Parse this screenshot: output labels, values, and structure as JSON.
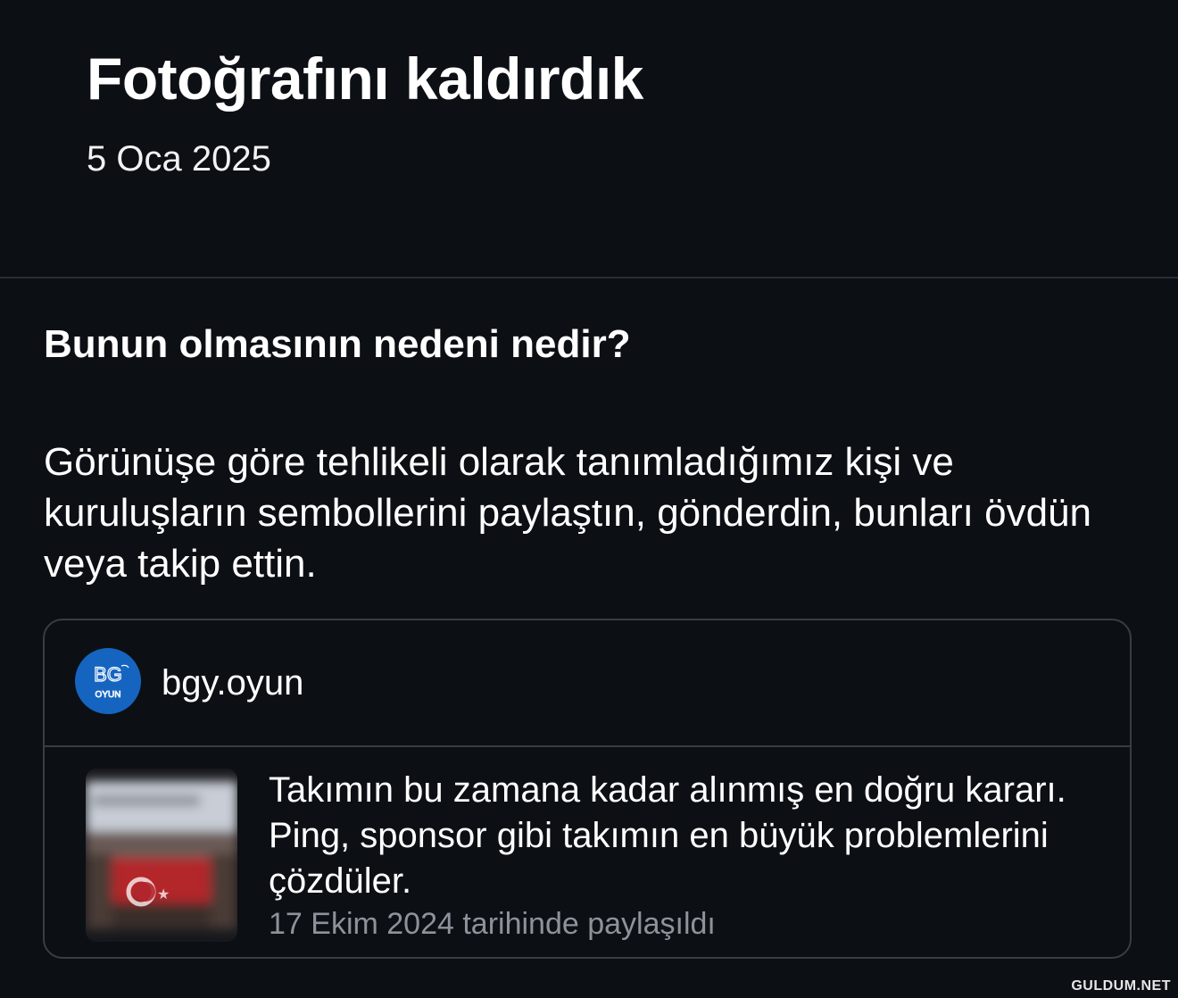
{
  "header": {
    "title": "Fotoğrafını kaldırdık",
    "date": "5 Oca 2025"
  },
  "reason": {
    "question": "Bunun olmasının nedeni nedir?",
    "explanation": "Görünüşe göre tehlikeli olarak tanımladığımız kişi ve kuruluşların sembollerini paylaştın, gönderdin, bunları övdün veya takip ettin."
  },
  "post": {
    "username": "bgy.oyun",
    "avatar_text": "OYUN",
    "avatar_color": "#1565c0",
    "text": "Takımın bu zamana kadar alınmış en doğru kararı. Ping, sponsor gibi takımın en büyük problemlerini çözdüler.",
    "shared_date": "17 Ekim 2024 tarihinde paylaşıldı"
  },
  "watermark": "GULDUM.NET",
  "colors": {
    "background": "#0c0f14",
    "border": "#3a3d44",
    "muted_text": "#8e929a"
  }
}
